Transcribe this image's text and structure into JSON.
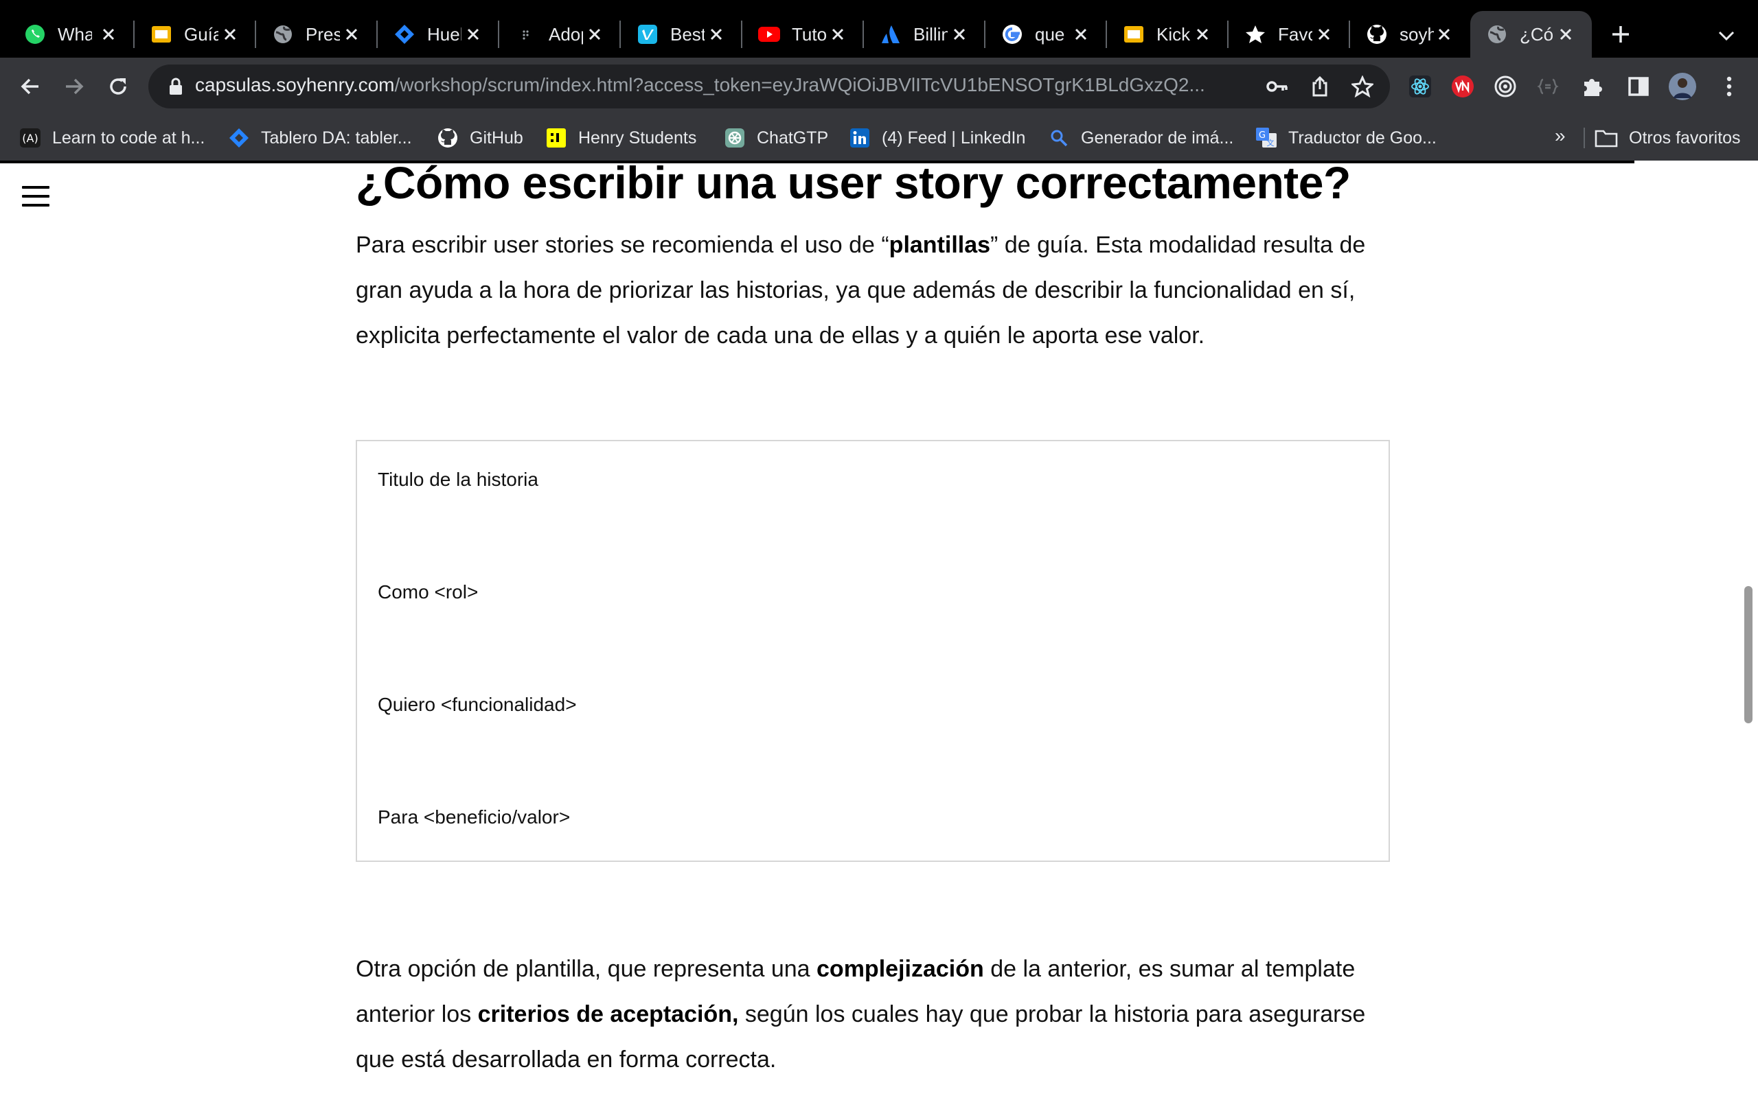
{
  "tabs": [
    {
      "label": "WhatsApp",
      "icon": "whatsapp-icon",
      "color": "#25d366"
    },
    {
      "label": "Guía",
      "icon": "slides-icon",
      "color": "#f4b400"
    },
    {
      "label": "Presentación",
      "icon": "globe-icon",
      "color": "#9aa0a6"
    },
    {
      "label": "Huella",
      "icon": "jira-icon",
      "color": "#2684ff"
    },
    {
      "label": "Adopción",
      "icon": "dots-icon",
      "color": "#9aa0a6"
    },
    {
      "label": "Best",
      "icon": "vimeo-icon",
      "color": "#1ab7ea"
    },
    {
      "label": "Tutorial",
      "icon": "youtube-icon",
      "color": "#ff0000"
    },
    {
      "label": "Billing",
      "icon": "atlassian-icon",
      "color": "#2684ff"
    },
    {
      "label": "que",
      "icon": "google-icon",
      "color": "#4285f4"
    },
    {
      "label": "Kickoff",
      "icon": "slides-icon",
      "color": "#f4b400"
    },
    {
      "label": "Favoritos",
      "icon": "star-icon",
      "color": "#ffffff"
    },
    {
      "label": "soyhenry",
      "icon": "github-icon",
      "color": "#ffffff"
    },
    {
      "label": "¿Cómo",
      "icon": "globe-icon",
      "color": "#9aa0a6",
      "active": true
    }
  ],
  "toolbar": {
    "url_host": "capsulas.soyhenry.com",
    "url_path": "/workshop/scrum/index.html?access_token=eyJraWQiOiJBVlITcVU1bENSOTgrK1BLdGxzQ2..."
  },
  "bookmarks": [
    {
      "label": "Learn to code at h...",
      "icon": "henry-icon"
    },
    {
      "label": "Tablero DA: tabler...",
      "icon": "jira-icon"
    },
    {
      "label": "GitHub",
      "icon": "github-icon"
    },
    {
      "label": "Henry Students",
      "icon": "henry-students-icon"
    },
    {
      "label": "ChatGTP",
      "icon": "chatgpt-icon"
    },
    {
      "label": "(4) Feed | LinkedIn",
      "icon": "linkedin-icon"
    },
    {
      "label": "Generador de imá...",
      "icon": "search-icon"
    },
    {
      "label": "Traductor de Goo...",
      "icon": "translate-icon"
    }
  ],
  "bookmarks_more": "»",
  "bookmarks_other": "Otros favoritos",
  "article": {
    "heading": "¿Cómo escribir una user story correctamente?",
    "p1_before": "Para escribir user stories se recomienda el uso de “",
    "p1_bold": "plantillas",
    "p1_after": "” de guía. Esta modalidad resulta de gran ayuda a la hora de priorizar las historias, ya que además de describir la funcionalidad en sí, explicita perfectamente el valor de cada una de ellas y a quién le aporta ese valor.",
    "template_lines": [
      "Titulo de la historia",
      "Como <rol>",
      "Quiero <funcionalidad>",
      "Para <beneficio/valor>"
    ],
    "p2_before": "Otra opción de plantilla, que representa una ",
    "p2_bold1": "complejización",
    "p2_mid": " de la anterior, es sumar al template anterior los ",
    "p2_bold2": "criterios de aceptación,",
    "p2_after": " según los cuales hay que probar la historia para asegurarse que está desarrollada en forma correcta."
  }
}
